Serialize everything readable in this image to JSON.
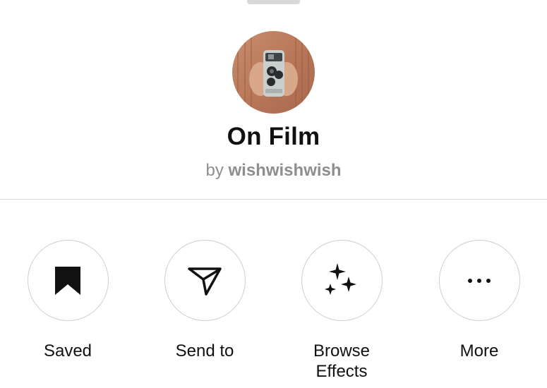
{
  "effect": {
    "title": "On Film",
    "byline_prefix": "by",
    "author": "wishwishwish"
  },
  "actions": [
    {
      "label": "Saved",
      "icon": "bookmark-filled-icon"
    },
    {
      "label": "Send to",
      "icon": "paper-plane-icon"
    },
    {
      "label": "Browse\nEffects",
      "icon": "sparkles-icon"
    },
    {
      "label": "More",
      "icon": "more-dots-icon"
    }
  ],
  "colors": {
    "text": "#111111",
    "muted": "#8e8e8e",
    "divider": "#dbdbdb",
    "circle_border": "#cfcfcf"
  }
}
